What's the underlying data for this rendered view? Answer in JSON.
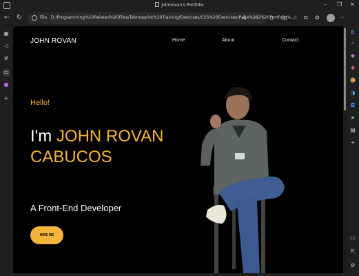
{
  "browser": {
    "tab_title": "Johnrovan's Portfolio",
    "url_prefix": "File",
    "url": "D:/Programming%20Related%20Files/Teknosprint%20Training/Exercises/CSS%20Exercises/Page%202%20Portfolio%..."
  },
  "site": {
    "brand": "JOHN ROVAN",
    "nav": [
      "Home",
      "About",
      "Contact"
    ],
    "greeting": "Hello!",
    "headline_prefix": "I'm",
    "headline_name": "JOHN ROVAN CABUCOS",
    "role": "A Front-End Developer",
    "cta": "HIRE ME"
  },
  "colors": {
    "accent": "#f5b43a",
    "page_bg": "#000000",
    "browser_bg": "#1f1f1f"
  }
}
